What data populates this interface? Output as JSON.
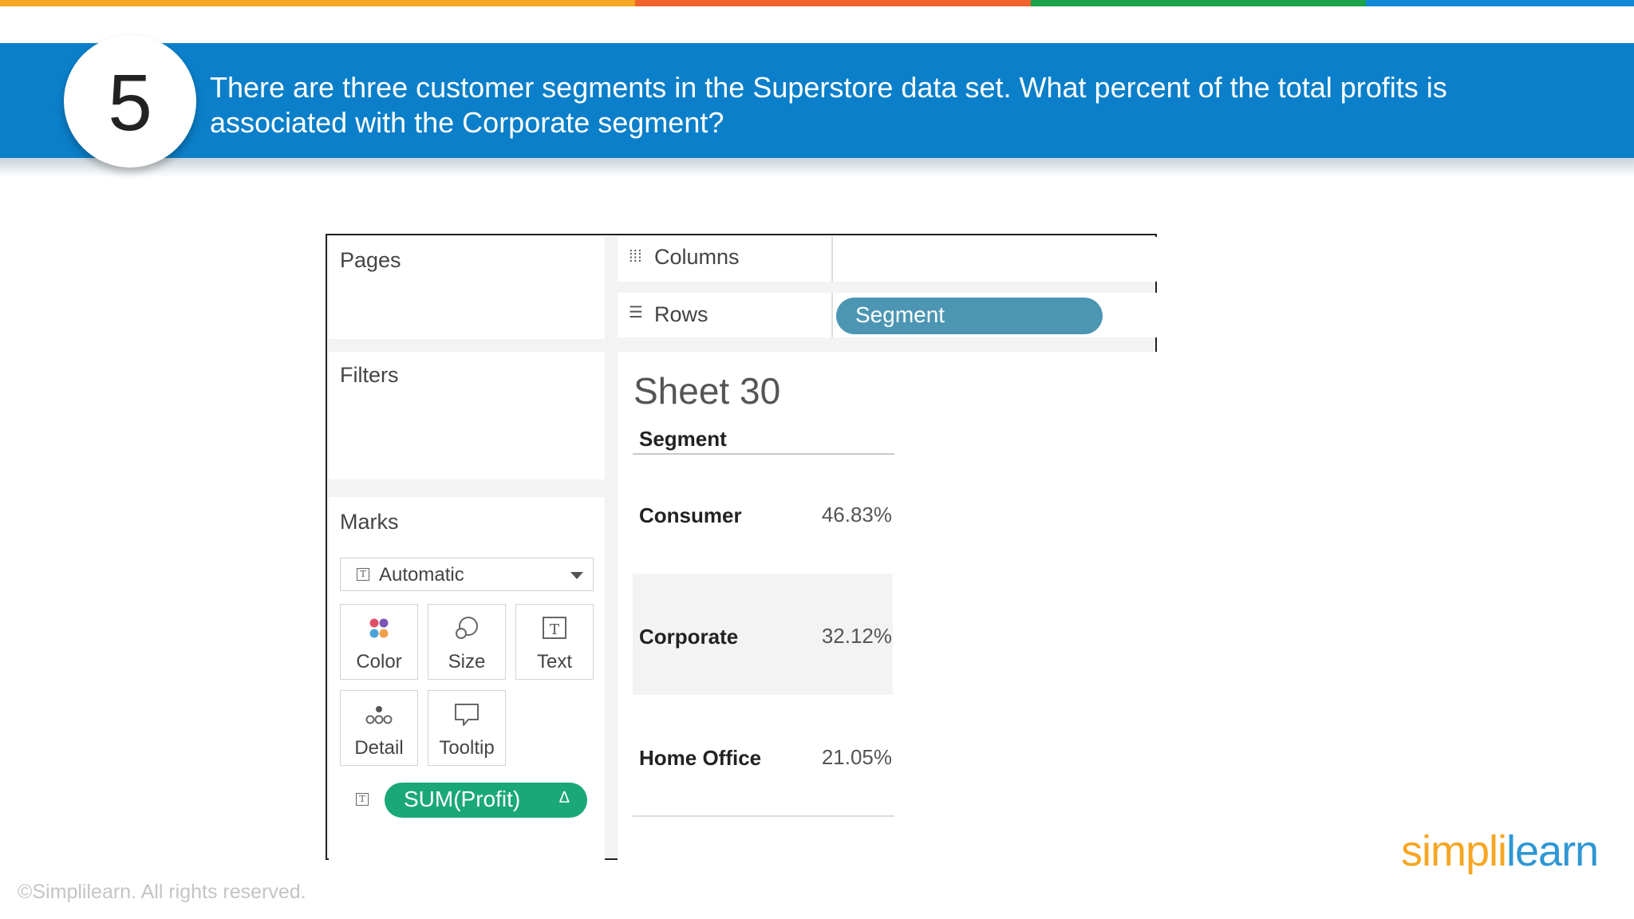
{
  "colors": {
    "accent_orange": "#f5a623",
    "accent_red_orange": "#f0642b",
    "accent_green": "#1aa34a",
    "accent_blue": "#1188d6",
    "banner_blue": "#0b7fc9",
    "segment_pill": "#4c96b4",
    "profit_pill": "#1aa879"
  },
  "question": {
    "number": "5",
    "text": "There are three customer segments in the Superstore data set. What percent of the total profits is associated with the Corporate segment?"
  },
  "shelves": {
    "pages": "Pages",
    "filters": "Filters",
    "marks": "Marks",
    "columns": "Columns",
    "rows": "Rows",
    "rows_pill": "Segment"
  },
  "marks": {
    "mark_type": "Automatic",
    "buttons": {
      "color": "Color",
      "size": "Size",
      "text": "Text",
      "detail": "Detail",
      "tooltip": "Tooltip"
    },
    "measure_pill": "SUM(Profit)",
    "measure_delta": "Δ"
  },
  "sheet": {
    "title": "Sheet 30",
    "column_header": "Segment",
    "rows": [
      {
        "segment": "Consumer",
        "value": "46.83%"
      },
      {
        "segment": "Corporate",
        "value": "32.12%"
      },
      {
        "segment": "Home Office",
        "value": "21.05%"
      }
    ]
  },
  "footer": {
    "copyright": "©Simplilearn. All rights reserved.",
    "logo_part1": "simpli",
    "logo_part2": "learn"
  }
}
